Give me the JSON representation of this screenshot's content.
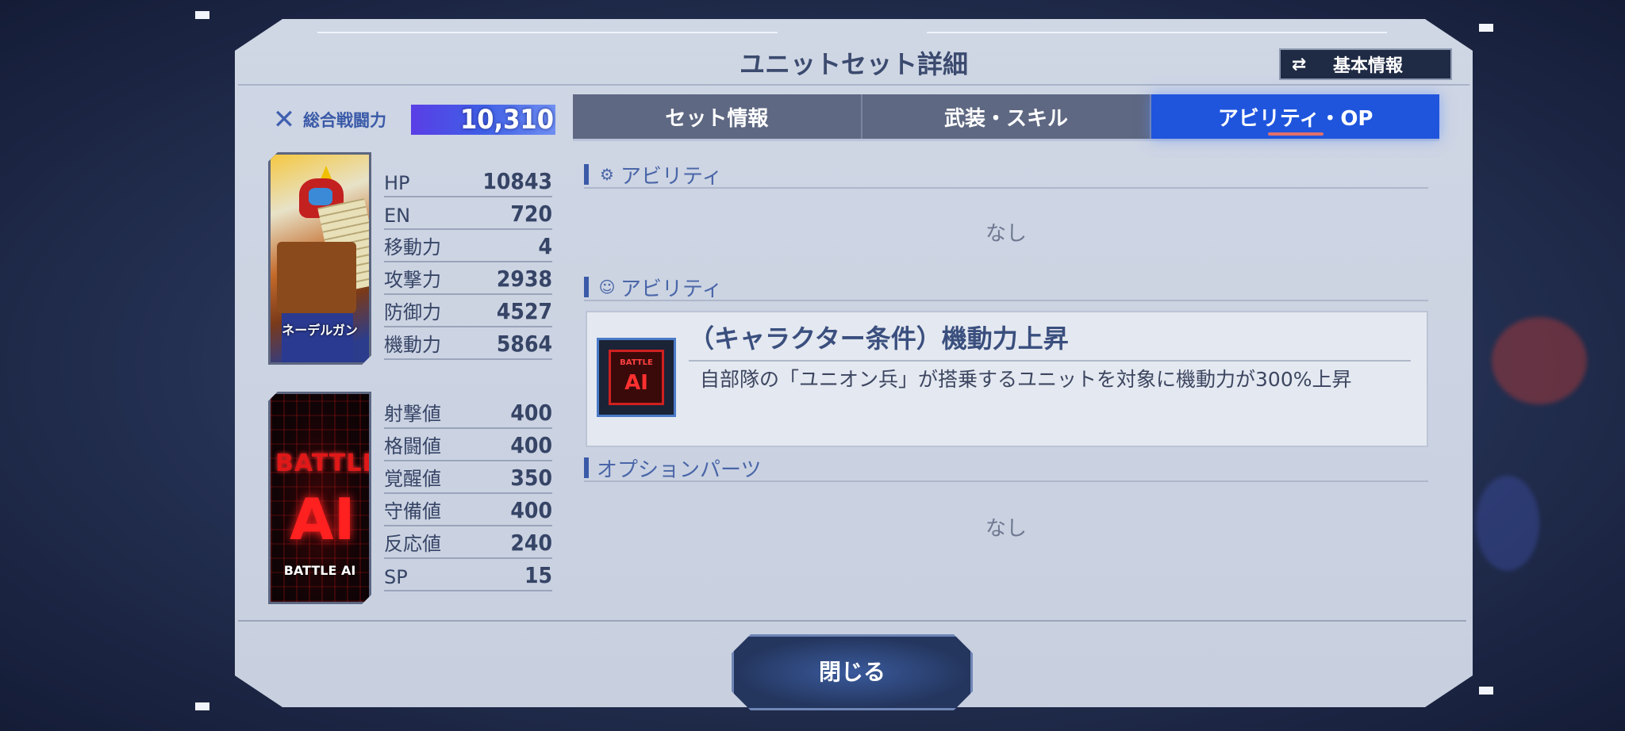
{
  "title": "ユニットセット詳細",
  "basic_info_button": "基本情報",
  "power": {
    "label": "総合戦闘力",
    "value": "10,310"
  },
  "unit_card": {
    "name": "ネーデルガン"
  },
  "ai_card": {
    "name": "BATTLE AI",
    "art_top": "BATTLE",
    "art_main": "AI"
  },
  "unit_stats": [
    {
      "label": "HP",
      "value": "10843"
    },
    {
      "label": "EN",
      "value": "720"
    },
    {
      "label": "移動力",
      "value": "4"
    },
    {
      "label": "攻撃力",
      "value": "2938"
    },
    {
      "label": "防御力",
      "value": "4527"
    },
    {
      "label": "機動力",
      "value": "5864"
    }
  ],
  "ai_stats": [
    {
      "label": "射撃値",
      "value": "400"
    },
    {
      "label": "格闘値",
      "value": "400"
    },
    {
      "label": "覚醒値",
      "value": "350"
    },
    {
      "label": "守備値",
      "value": "400"
    },
    {
      "label": "反応値",
      "value": "240"
    },
    {
      "label": "SP",
      "value": "15"
    }
  ],
  "tabs": [
    {
      "label": "セット情報",
      "active": false
    },
    {
      "label": "武装・スキル",
      "active": false
    },
    {
      "label": "アビリティ・OP",
      "active": true
    }
  ],
  "sections": {
    "unit_ability": {
      "title": "アビリティ",
      "empty": "なし"
    },
    "pilot_ability": {
      "title": "アビリティ"
    },
    "option_parts": {
      "title": "オプションパーツ",
      "empty": "なし"
    }
  },
  "ability": {
    "icon_top": "BATTLE",
    "icon_main": "AI",
    "name": "（キャラクター条件）機動力上昇",
    "description": "自部隊の「ユニオン兵」が搭乗するユニットを対象に機動力が300%上昇"
  },
  "close_button": "閉じる",
  "colors": {
    "accent": "#1f55dd",
    "title": "#3b4a6e",
    "power_bar": "#4a4ee6"
  }
}
